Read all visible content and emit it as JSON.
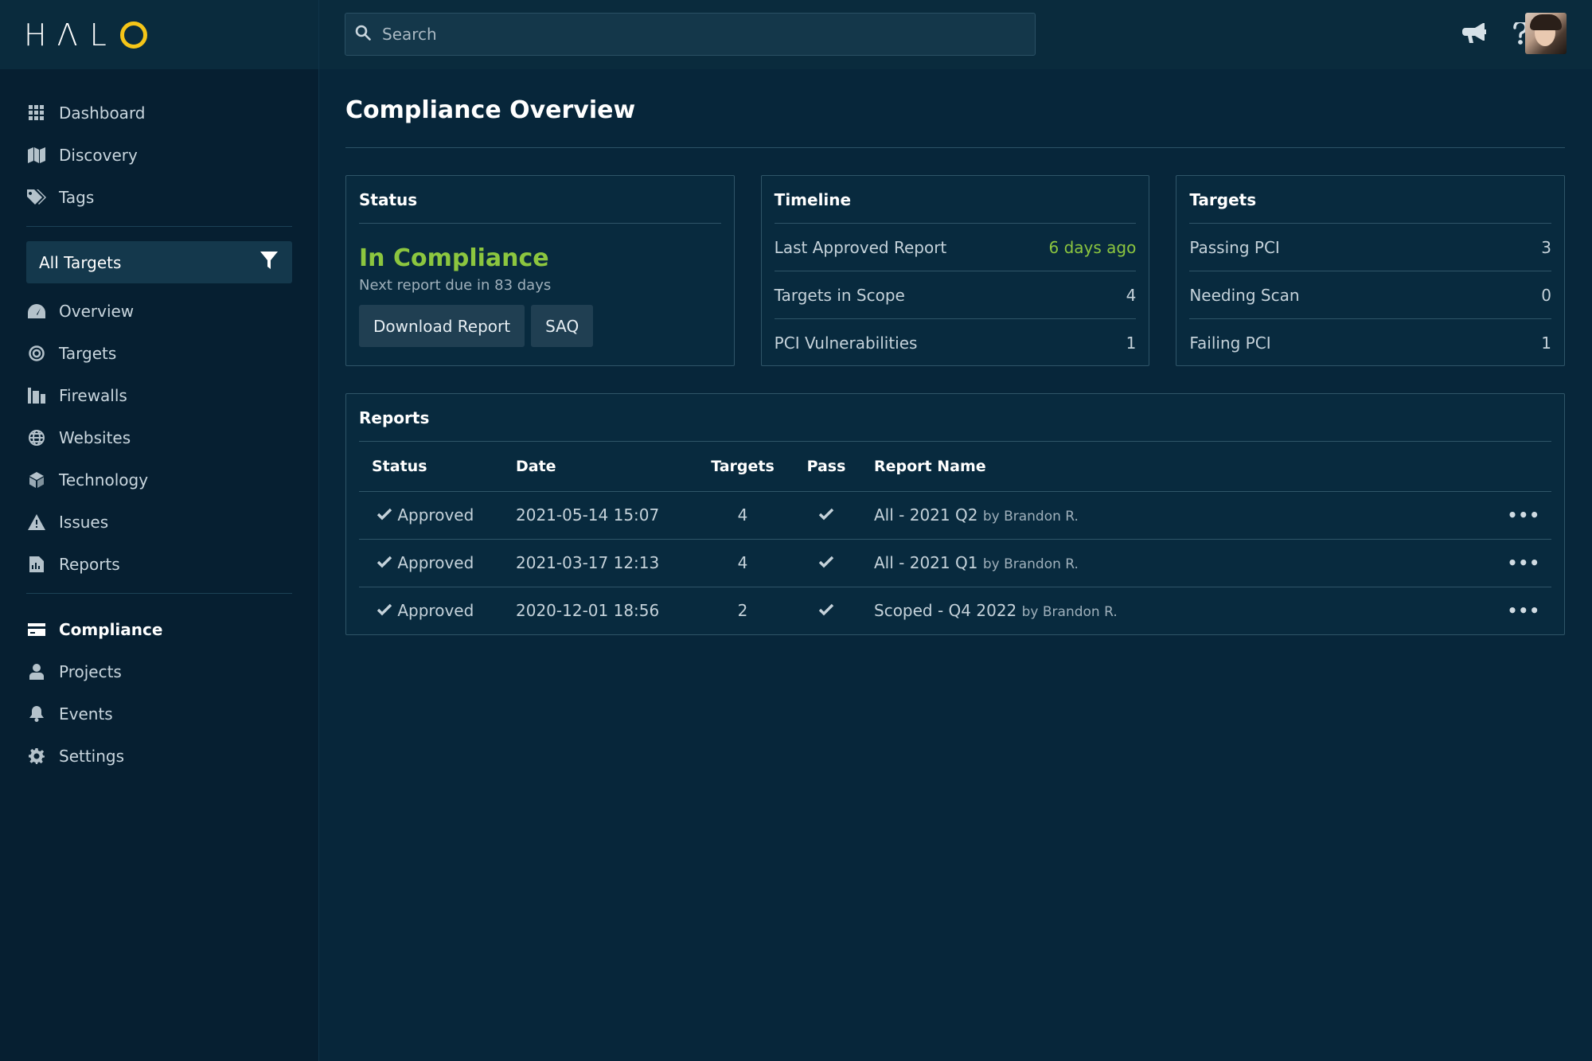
{
  "app": {
    "logo": "HALO"
  },
  "search": {
    "placeholder": "Search"
  },
  "sidebar": {
    "top_items": [
      {
        "label": "Dashboard",
        "icon": "grid-icon"
      },
      {
        "label": "Discovery",
        "icon": "map-icon"
      },
      {
        "label": "Tags",
        "icon": "tags-icon"
      }
    ],
    "filter": {
      "label": "All Targets",
      "icon": "filter-icon"
    },
    "target_items": [
      {
        "label": "Overview",
        "icon": "gauge-icon"
      },
      {
        "label": "Targets",
        "icon": "target-icon"
      },
      {
        "label": "Firewalls",
        "icon": "firewall-icon"
      },
      {
        "label": "Websites",
        "icon": "globe-icon"
      },
      {
        "label": "Technology",
        "icon": "cube-icon"
      },
      {
        "label": "Issues",
        "icon": "warning-icon"
      },
      {
        "label": "Reports",
        "icon": "report-icon"
      }
    ],
    "bottom_items": [
      {
        "label": "Compliance",
        "icon": "credit-card-icon",
        "active": true
      },
      {
        "label": "Projects",
        "icon": "user-icon"
      },
      {
        "label": "Events",
        "icon": "bell-icon"
      },
      {
        "label": "Settings",
        "icon": "gear-icon"
      }
    ]
  },
  "header": {
    "icons": [
      "megaphone-icon",
      "help-icon",
      "avatar"
    ]
  },
  "page": {
    "title": "Compliance Overview"
  },
  "status_card": {
    "title": "Status",
    "status": "In Compliance",
    "subtext": "Next report due in 83 days",
    "download_label": "Download Report",
    "saq_label": "SAQ"
  },
  "timeline_card": {
    "title": "Timeline",
    "rows": [
      {
        "label": "Last Approved Report",
        "value": "6 days ago"
      },
      {
        "label": "Targets in Scope",
        "value": "4"
      },
      {
        "label": "PCI Vulnerabilities",
        "value": "1"
      }
    ]
  },
  "targets_card": {
    "title": "Targets",
    "rows": [
      {
        "label": "Passing PCI",
        "value": "3"
      },
      {
        "label": "Needing Scan",
        "value": "0"
      },
      {
        "label": "Failing PCI",
        "value": "1"
      }
    ]
  },
  "reports": {
    "title": "Reports",
    "columns": [
      "Status",
      "Date",
      "Targets",
      "Pass",
      "Report Name"
    ],
    "rows": [
      {
        "status": "Approved",
        "date": "2021-05-14 15:07",
        "targets": "4",
        "name": "All - 2021 Q2",
        "by": "by Brandon R."
      },
      {
        "status": "Approved",
        "date": "2021-03-17 12:13",
        "targets": "4",
        "name": "All - 2021 Q1",
        "by": "by Brandon R."
      },
      {
        "status": "Approved",
        "date": "2020-12-01 18:56",
        "targets": "2",
        "name": "Scoped - Q4 2022",
        "by": "by Brandon R."
      }
    ]
  },
  "colors": {
    "accent_green": "#8cc63f",
    "logo_yellow": "#f5c518",
    "background": "#07263a"
  }
}
